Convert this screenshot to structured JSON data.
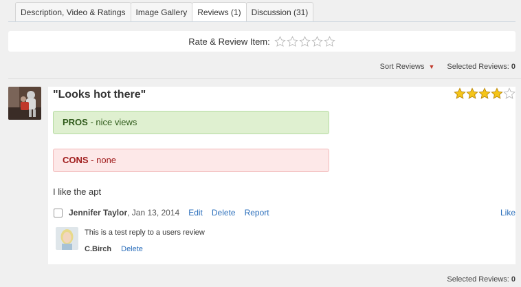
{
  "tabs": [
    {
      "label": "Description, Video & Ratings",
      "active": false
    },
    {
      "label": "Image Gallery",
      "active": false
    },
    {
      "label": "Reviews (1)",
      "active": true
    },
    {
      "label": "Discussion (31)",
      "active": false
    }
  ],
  "rate_item": {
    "label": "Rate & Review Item:",
    "stars_total": 5,
    "stars_selected": 0
  },
  "sort": {
    "label": "Sort Reviews",
    "selected_label": "Selected Reviews:",
    "selected_count": "0"
  },
  "review": {
    "title": "\"Looks hot there\"",
    "rating": 4,
    "rating_max": 5,
    "pros_label": "PROS",
    "pros_text": " - nice views",
    "cons_label": "CONS",
    "cons_text": " - none",
    "body": "I like the apt",
    "author": "Jennifer Taylor",
    "date": ", Jan 13, 2014",
    "actions": {
      "edit": "Edit",
      "delete": "Delete",
      "report": "Report",
      "like": "Like"
    },
    "reply": {
      "text": "This is a test reply to a users review",
      "author": "C.Birch",
      "delete": "Delete"
    }
  },
  "footer": {
    "selected_label": "Selected Reviews:",
    "selected_count": "0"
  },
  "colors": {
    "pros_bg": "#dff0d0",
    "cons_bg": "#fde8e8",
    "link": "#2a6ebb",
    "star_fill": "#f5c518"
  }
}
